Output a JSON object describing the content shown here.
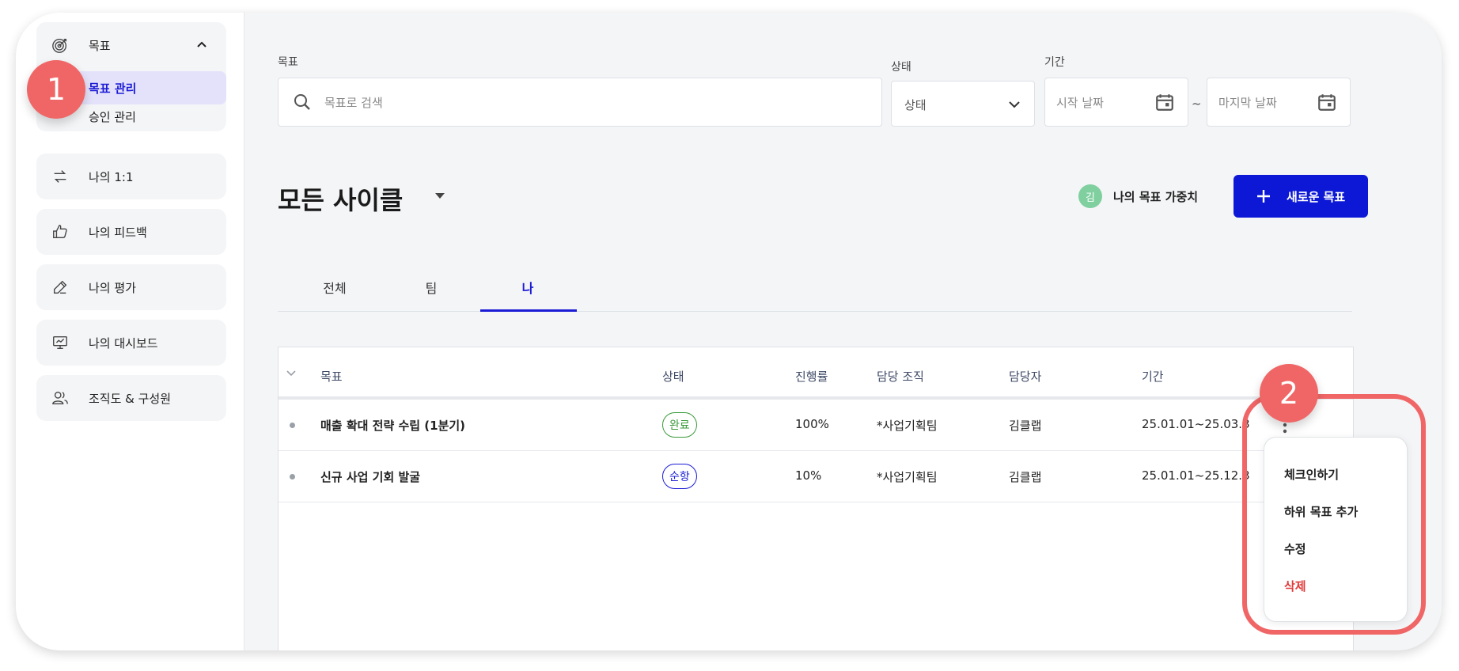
{
  "sidebar": {
    "goal_section": {
      "label": "목표",
      "sub_items": [
        "목표 관리",
        "승인 관리"
      ]
    },
    "items": [
      {
        "label": "나의 1:1",
        "icon": "swap-arrows-icon"
      },
      {
        "label": "나의 피드백",
        "icon": "thumbs-up-icon"
      },
      {
        "label": "나의 평가",
        "icon": "pen-icon"
      },
      {
        "label": "나의 대시보드",
        "icon": "presentation-board-icon"
      },
      {
        "label": "조직도 & 구성원",
        "icon": "people-icon"
      }
    ]
  },
  "filters": {
    "goal_label": "목표",
    "search_placeholder": "목표로 검색",
    "status_label": "상태",
    "status_value": "상태",
    "period_label": "기간",
    "start_placeholder": "시작 날짜",
    "end_placeholder": "마지막 날짜",
    "separator": "~"
  },
  "header": {
    "title": "모든 사이클",
    "avatar_initial": "김",
    "weight_label": "나의 목표 가중치",
    "new_goal_button": "새로운 목표"
  },
  "tabs": [
    {
      "label": "전체",
      "active": false
    },
    {
      "label": "팀",
      "active": false
    },
    {
      "label": "나",
      "active": true
    }
  ],
  "table": {
    "columns": [
      "목표",
      "상태",
      "진행률",
      "담당 조직",
      "담당자",
      "기간"
    ],
    "rows": [
      {
        "goal": "매출 확대 전략 수립 (1분기)",
        "status": "완료",
        "status_color": "#3a9a3a",
        "progress": "100%",
        "org": "*사업기획팀",
        "owner": "김클랩",
        "period": "25.01.01~25.03.3"
      },
      {
        "goal": "신규 사업 기회 발굴",
        "status": "순항",
        "status_color": "#1b1bd6",
        "progress": "10%",
        "org": "*사업기획팀",
        "owner": "김클랩",
        "period": "25.01.01~25.12.3"
      }
    ]
  },
  "context_menu": {
    "items": [
      "체크인하기",
      "하위 목표 추가",
      "수정",
      "삭제"
    ],
    "danger_color": "#e03b3b"
  },
  "markers": [
    "1",
    "2"
  ],
  "colors": {
    "accent": "#0c18d6",
    "marker": "#f06666",
    "active_bg": "#e4e2fb"
  }
}
